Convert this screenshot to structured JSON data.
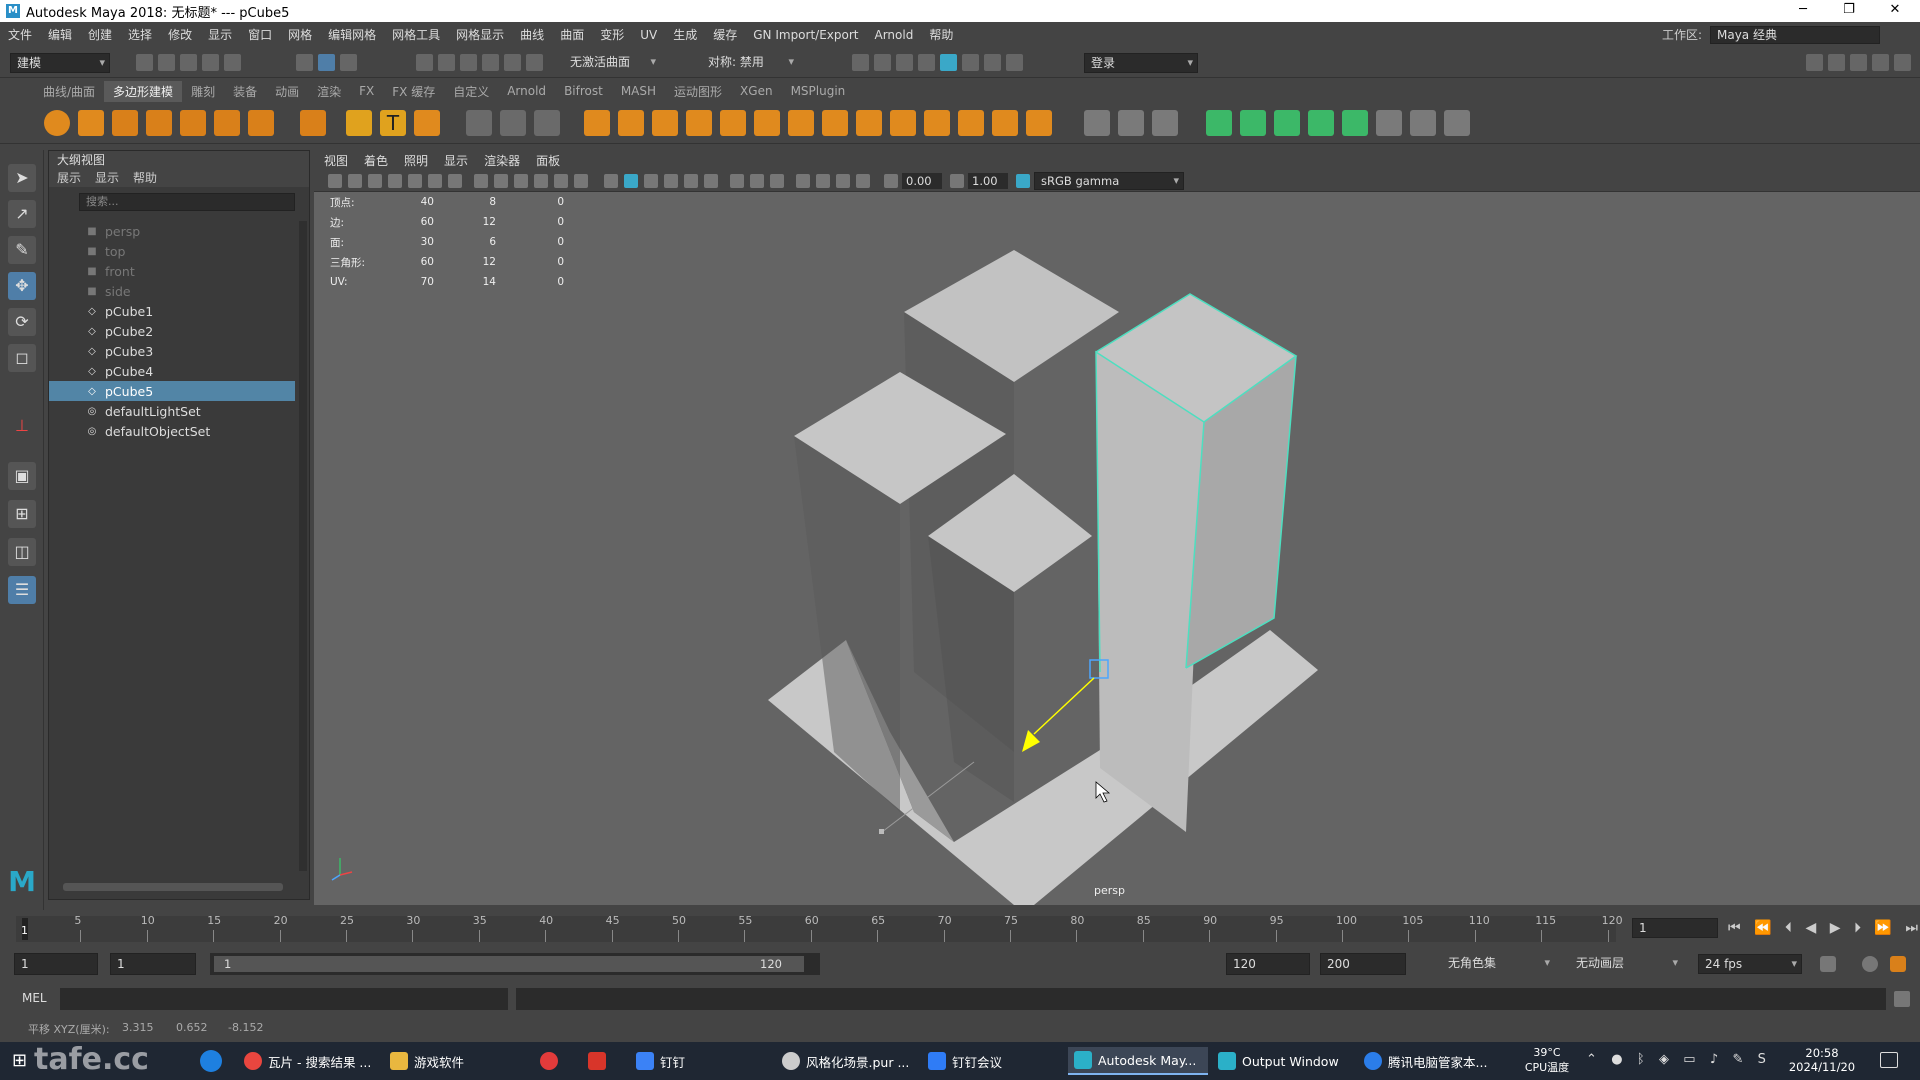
{
  "titlebar": {
    "title": "Autodesk Maya 2018: 无标题*   ---   pCube5",
    "logo_text": "M",
    "minimize": "─",
    "restore": "❐",
    "close": "✕"
  },
  "menubar": {
    "items": [
      "文件",
      "编辑",
      "创建",
      "选择",
      "修改",
      "显示",
      "窗口",
      "网格",
      "编辑网格",
      "网格工具",
      "网格显示",
      "曲线",
      "曲面",
      "变形",
      "UV",
      "生成",
      "缓存",
      "GN Import/Export",
      "Arnold",
      "帮助"
    ],
    "workspace_label": "工作区:",
    "workspace_value": "Maya 经典"
  },
  "statusline": {
    "mode": "建模",
    "live_surface": "无激活曲面",
    "symmetry": "对称: 禁用",
    "login": "登录"
  },
  "shelf": {
    "tabs": [
      "曲线/曲面",
      "多边形建模",
      "雕刻",
      "装备",
      "动画",
      "渲染",
      "FX",
      "FX 缓存",
      "自定义",
      "Arnold",
      "Bifrost",
      "MASH",
      "运动图形",
      "XGen",
      "MSPlugin"
    ],
    "active_tab": "多边形建模"
  },
  "outliner": {
    "title": "大纲视图",
    "menus": [
      "展示",
      "显示",
      "帮助"
    ],
    "search_placeholder": "搜索...",
    "items": [
      {
        "label": "persp",
        "type": "camera",
        "dim": true
      },
      {
        "label": "top",
        "type": "camera",
        "dim": true
      },
      {
        "label": "front",
        "type": "camera",
        "dim": true
      },
      {
        "label": "side",
        "type": "camera",
        "dim": true
      },
      {
        "label": "pCube1",
        "type": "mesh"
      },
      {
        "label": "pCube2",
        "type": "mesh"
      },
      {
        "label": "pCube3",
        "type": "mesh"
      },
      {
        "label": "pCube4",
        "type": "mesh"
      },
      {
        "label": "pCube5",
        "type": "mesh",
        "selected": true
      },
      {
        "label": "defaultLightSet",
        "type": "set"
      },
      {
        "label": "defaultObjectSet",
        "type": "set"
      }
    ]
  },
  "viewport": {
    "menus": [
      "视图",
      "着色",
      "照明",
      "显示",
      "渲染器",
      "面板"
    ],
    "exposure": "0.00",
    "gamma": "1.00",
    "color_space": "sRGB gamma",
    "camera_label": "persp",
    "hud": [
      {
        "label": "顶点:",
        "a": "40",
        "b": "8",
        "c": "0"
      },
      {
        "label": "边:",
        "a": "60",
        "b": "12",
        "c": "0"
      },
      {
        "label": "面:",
        "a": "30",
        "b": "6",
        "c": "0"
      },
      {
        "label": "三角形:",
        "a": "60",
        "b": "12",
        "c": "0"
      },
      {
        "label": "UV:",
        "a": "70",
        "b": "14",
        "c": "0"
      }
    ],
    "colors": {
      "background": "#646464",
      "surface": "#c4c4c4",
      "selection": "#4ddfc0",
      "manipulator": "#ffff00"
    }
  },
  "timeline": {
    "ticks": [
      "5",
      "10",
      "15",
      "20",
      "25",
      "30",
      "35",
      "40",
      "45",
      "50",
      "55",
      "60",
      "65",
      "70",
      "75",
      "80",
      "85",
      "90",
      "95",
      "100",
      "105",
      "110",
      "115",
      "120"
    ],
    "start_marker": "1",
    "current_frame": "1"
  },
  "range": {
    "start": "1",
    "anim_start": "1",
    "range_start": "1",
    "range_end": "120",
    "end": "120",
    "anim_end": "200",
    "character_set": "无角色集",
    "anim_layer": "无动画层",
    "fps": "24 fps"
  },
  "cmdline": {
    "label": "MEL"
  },
  "helpline": {
    "label": "平移 XYZ(厘米):",
    "x": "3.315",
    "y": "0.652",
    "z": "-8.152"
  },
  "watermark": "tafe.cc",
  "taskbar": {
    "items": [
      {
        "label": "瓦片 - 搜索结果 ...",
        "color": "#e9463f"
      },
      {
        "label": "游戏软件",
        "color": "#e9b73f"
      },
      {
        "label": "",
        "color": "#e23b3b"
      },
      {
        "label": "",
        "color": "#d8352a"
      },
      {
        "label": "钉钉",
        "color": "#3b82f6"
      },
      {
        "label": "风格化场景.pur ...",
        "color": "#cccccc"
      },
      {
        "label": "钉钉会议",
        "color": "#2f7cf6"
      },
      {
        "label": "Autodesk May...",
        "color": "#2bb0c8",
        "active": true
      },
      {
        "label": "Output Window",
        "color": "#2bb0c8"
      },
      {
        "label": "腾讯电脑管家本...",
        "color": "#2b7de9"
      }
    ],
    "temp": "39°C",
    "temp_label": "CPU温度",
    "time": "20:58",
    "date": "2024/11/20"
  }
}
